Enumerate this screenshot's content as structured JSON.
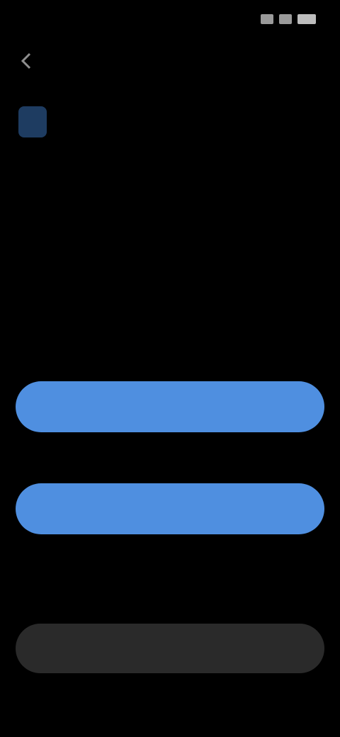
{
  "status_bar": {
    "time": "",
    "icons": [
      "signal-icon",
      "wifi-icon",
      "battery-icon"
    ]
  },
  "header": {
    "back_icon": "back-arrow-icon"
  },
  "main": {
    "app_icon_color": "#1e3c61",
    "title": "",
    "subtitle": ""
  },
  "actions": {
    "primary_label": "",
    "secondary_label": "",
    "link_label": "",
    "bottom_label": ""
  },
  "colors": {
    "primary_button": "#4f8fe0",
    "bottom_button": "#2a2a2a",
    "background": "#000000"
  }
}
